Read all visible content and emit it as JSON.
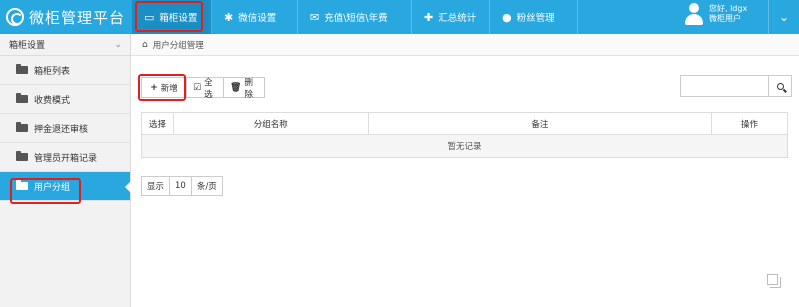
{
  "brand": {
    "title": "微柜管理平台",
    "logo_icon": "cabinet-logo-icon"
  },
  "nav": [
    {
      "label": "箱柜设置",
      "icon": "monitor-icon",
      "glyph": "▭",
      "active": true
    },
    {
      "label": "微信设置",
      "icon": "gear-icon",
      "glyph": "✱"
    },
    {
      "label": "充值\\短信\\年费",
      "icon": "mail-icon",
      "glyph": "✉"
    },
    {
      "label": "汇总统计",
      "icon": "puzzle-icon",
      "glyph": "✚"
    },
    {
      "label": "粉丝管理",
      "icon": "user-icon",
      "glyph": "●"
    }
  ],
  "user": {
    "greeting": "您好, ldgx",
    "role": "微柜用户",
    "toggle": "⌄"
  },
  "sidebar": {
    "section": "箱柜设置",
    "items": [
      {
        "label": "箱柜列表"
      },
      {
        "label": "收费模式"
      },
      {
        "label": "押金退还审核"
      },
      {
        "label": "管理员开箱记录"
      },
      {
        "label": "用户分组",
        "active": true
      }
    ]
  },
  "breadcrumb": {
    "home_glyph": "⌂",
    "label": "用户分组管理"
  },
  "toolbar": {
    "add": {
      "glyph": "+",
      "label": "新增"
    },
    "select_all": {
      "glyph": "☑",
      "label": "全选"
    },
    "delete": {
      "glyph": "🗑",
      "label": "删除"
    }
  },
  "search": {
    "placeholder": "",
    "value": ""
  },
  "table": {
    "columns": [
      "选择",
      "分组名称",
      "备注",
      "操作"
    ],
    "empty_text": "暂无记录"
  },
  "pager": {
    "show_label": "显示",
    "page_size": "10",
    "unit_label": "条/页"
  },
  "colors": {
    "accent": "#29a7df",
    "accent_dark": "#1b8fc4",
    "highlight": "#e02020"
  }
}
